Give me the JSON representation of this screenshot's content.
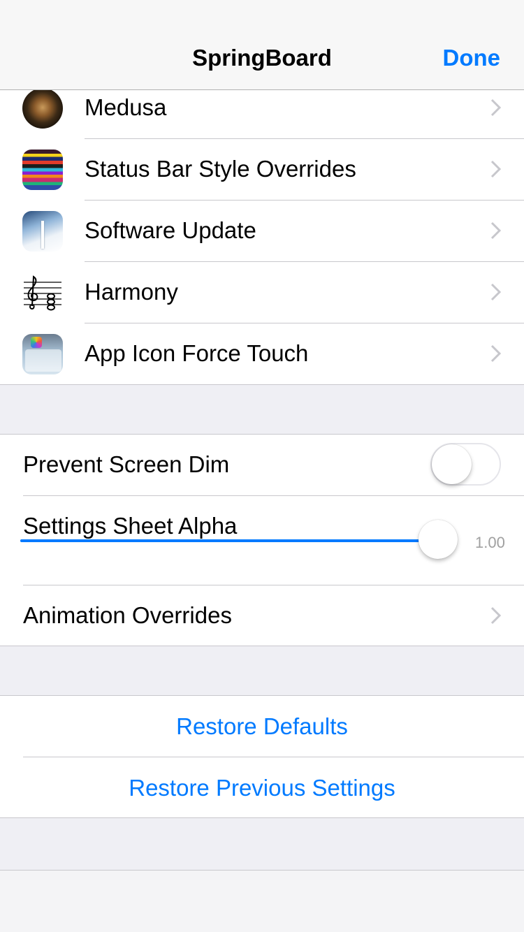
{
  "navbar": {
    "title": "SpringBoard",
    "done_label": "Done",
    "accent_color": "#007aff"
  },
  "link_rows": [
    {
      "label": "Medusa",
      "icon": "medusa-icon"
    },
    {
      "label": "Status Bar Style Overrides",
      "icon": "status-bar-style-icon"
    },
    {
      "label": "Software Update",
      "icon": "software-update-icon"
    },
    {
      "label": "Harmony",
      "icon": "harmony-music-icon"
    },
    {
      "label": "App Icon Force Touch",
      "icon": "force-touch-icon"
    }
  ],
  "settings": {
    "prevent_screen_dim": {
      "label": "Prevent Screen Dim",
      "enabled": false
    },
    "settings_sheet_alpha": {
      "label": "Settings Sheet Alpha",
      "value": 1.0,
      "value_text": "1.00"
    },
    "animation_overrides": {
      "label": "Animation Overrides"
    }
  },
  "actions": {
    "restore_defaults": "Restore Defaults",
    "restore_previous": "Restore Previous Settings"
  }
}
